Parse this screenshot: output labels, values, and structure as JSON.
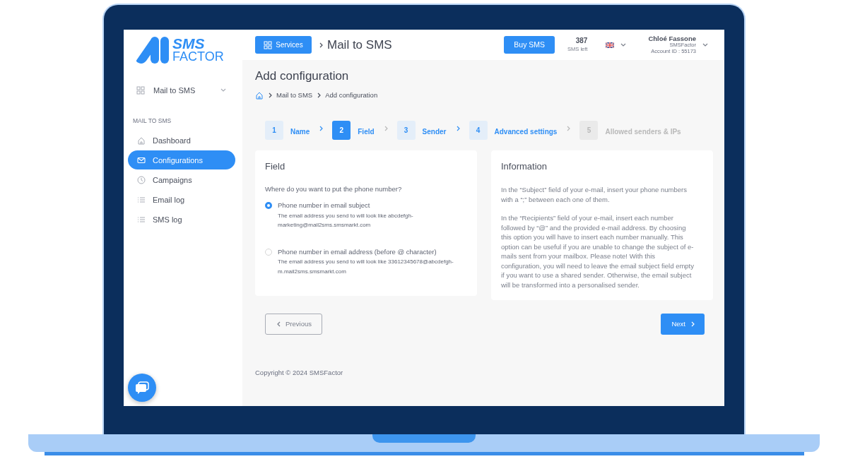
{
  "logo": {
    "line_1": "SMS",
    "line_2": "FACTOR"
  },
  "sidebar": {
    "service_select": "Mail to SMS",
    "section_label": "MAIL TO SMS",
    "items": [
      {
        "label": "Dashboard",
        "selected": false
      },
      {
        "label": "Configurations",
        "selected": true
      },
      {
        "label": "Campaigns",
        "selected": false
      },
      {
        "label": "Email log",
        "selected": false
      },
      {
        "label": "SMS log",
        "selected": false
      }
    ]
  },
  "topbar": {
    "services_button": "Services",
    "page_title": "Mail to SMS",
    "buy_button": "Buy SMS",
    "credits": "387",
    "credits_label": "SMS left",
    "user": {
      "name": "Chloé Fassone",
      "company": "SMSFactor",
      "account": "Account ID : 55173"
    }
  },
  "page": {
    "title": "Add configuration",
    "breadcrumb": [
      "Mail to SMS",
      "Add configuration"
    ],
    "steps": [
      {
        "number": "1",
        "label": "Name",
        "selected": false,
        "disabled": false
      },
      {
        "number": "2",
        "label": "Field",
        "selected": true,
        "disabled": false
      },
      {
        "number": "3",
        "label": "Sender",
        "selected": false,
        "disabled": false
      },
      {
        "number": "4",
        "label": "Advanced settings",
        "selected": false,
        "disabled": false
      },
      {
        "number": "5",
        "label": "Allowed senders & IPs",
        "selected": false,
        "disabled": true
      }
    ],
    "field_card": {
      "title": "Field",
      "question": "Where do you want to put the phone number?",
      "options": [
        {
          "label": "Phone number in email subject",
          "hint": "The email address you send to will look like abcdefgh-marketing@mail2sms.smsmarkt.com",
          "selected": true
        },
        {
          "label": "Phone number in email address (before @ character)",
          "hint": "The email address you send to will look like 33612345678@abcdefgh-m.mail2sms.smsmarkt.com",
          "selected": false
        }
      ]
    },
    "info_card": {
      "title": "Information",
      "paragraphs": [
        "In the “Subject” field of your e-mail, insert your phone numbers with a “;” between each one of them.",
        "In the “Recipients” field of your e-mail, insert each number followed by “@” and the provided e-mail address. By choosing this option you will have to insert each number manually. This option can be useful if you are unable to change the subject of e-mails sent from your mailbox. Please note! With this configuration, you will need to leave the email subject field empty if you want to use a shared sender. Otherwise, the email subject will be transformed into a personalised sender."
      ]
    },
    "previous_button": "Previous",
    "next_button": "Next",
    "copyright": "Copyright © 2024 SMSFactor"
  }
}
